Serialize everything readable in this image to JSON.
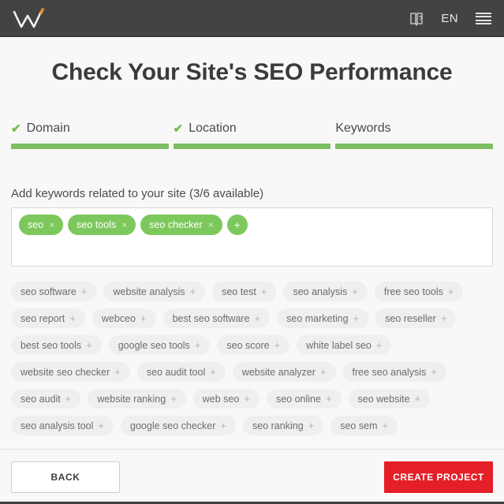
{
  "header": {
    "logo_name": "webceo-w-logo",
    "help_icon": "book-question-icon",
    "language": "EN",
    "menu_icon": "hamburger-menu-icon"
  },
  "page_title": "Check Your Site's SEO Performance",
  "steps": [
    {
      "label": "Domain",
      "completed": true,
      "check": "✔"
    },
    {
      "label": "Location",
      "completed": true,
      "check": "✔"
    },
    {
      "label": "Keywords",
      "completed": false,
      "check": ""
    }
  ],
  "keywords": {
    "label": "Add keywords related to your site (3/6 available)",
    "available_used": 3,
    "available_total": 6,
    "selected": [
      {
        "text": "seo",
        "remove": "×"
      },
      {
        "text": "seo tools",
        "remove": "×"
      },
      {
        "text": "seo checker",
        "remove": "×"
      }
    ],
    "add_button": "+"
  },
  "suggestions": {
    "plus": "+",
    "items": [
      "seo software",
      "website analysis",
      "seo test",
      "seo analysis",
      "free seo tools",
      "seo report",
      "webceo",
      "best seo software",
      "seo marketing",
      "seo reseller",
      "best seo tools",
      "google seo tools",
      "seo score",
      "white label seo",
      "website seo checker",
      "seo audit tool",
      "website analyzer",
      "free seo analysis",
      "seo audit",
      "website ranking",
      "web seo",
      "seo online",
      "seo website",
      "seo analysis tool",
      "google seo checker",
      "seo ranking",
      "seo sem"
    ]
  },
  "footer": {
    "back_label": "BACK",
    "create_label": "CREATE PROJECT"
  },
  "colors": {
    "topbar": "#434343",
    "accent_green": "#7dc063",
    "chip_green": "#7dc85c",
    "create_red": "#e51f27",
    "logo_orange": "#f08a1e",
    "page_bg": "#f8f8f8"
  }
}
